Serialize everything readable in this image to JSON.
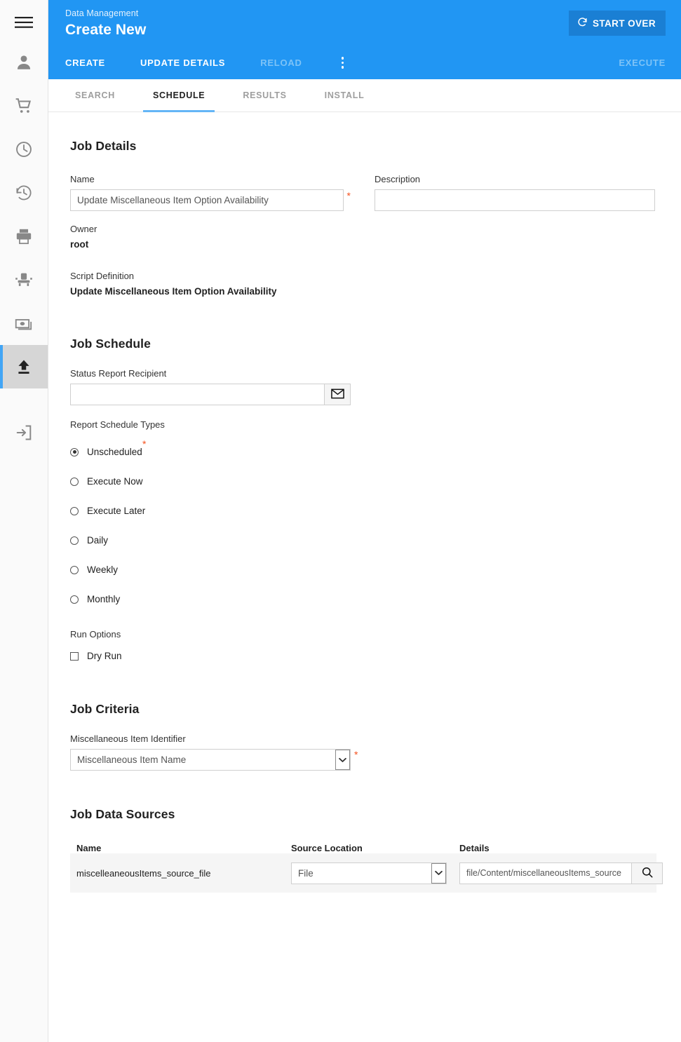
{
  "sidebar": {
    "items": [
      {
        "icon": "hamburger-menu-icon",
        "name": "menu-toggle"
      },
      {
        "icon": "person-icon",
        "name": "sidebar-item-person"
      },
      {
        "icon": "shopping-cart-icon",
        "name": "sidebar-item-cart"
      },
      {
        "icon": "clock-icon",
        "name": "sidebar-item-clock"
      },
      {
        "icon": "history-icon",
        "name": "sidebar-item-history"
      },
      {
        "icon": "printer-icon",
        "name": "sidebar-item-printer"
      },
      {
        "icon": "seat-icon",
        "name": "sidebar-item-seat"
      },
      {
        "icon": "cash-icon",
        "name": "sidebar-item-cash"
      },
      {
        "icon": "upload-icon",
        "name": "sidebar-item-upload"
      },
      {
        "icon": "logout-icon",
        "name": "sidebar-item-logout"
      }
    ]
  },
  "header": {
    "breadcrumb": "Data Management",
    "title": "Create New",
    "start_over_label": "START OVER",
    "accent_color": "#2196f3",
    "start_over_color": "#1a7fd4"
  },
  "toolbar": {
    "create_label": "CREATE",
    "update_details_label": "UPDATE DETAILS",
    "reload_label": "RELOAD",
    "execute_label": "EXECUTE"
  },
  "tabs": [
    {
      "label": "SEARCH",
      "active": false
    },
    {
      "label": "SCHEDULE",
      "active": true
    },
    {
      "label": "RESULTS",
      "active": false
    },
    {
      "label": "INSTALL",
      "active": false
    }
  ],
  "job_details": {
    "heading": "Job Details",
    "name_label": "Name",
    "name_value": "Update Miscellaneous Item Option Availability",
    "name_required": "*",
    "description_label": "Description",
    "description_value": "",
    "owner_label": "Owner",
    "owner_value": "root",
    "script_definition_label": "Script Definition",
    "script_definition_value": "Update Miscellaneous Item Option Availability"
  },
  "job_schedule": {
    "heading": "Job Schedule",
    "recipient_label": "Status Report Recipient",
    "recipient_value": "",
    "email_button_icon": "envelope-icon",
    "schedule_types_label": "Report Schedule Types",
    "schedule_required": "*",
    "schedule_types": [
      {
        "label": "Unscheduled",
        "checked": true
      },
      {
        "label": "Execute Now",
        "checked": false
      },
      {
        "label": "Execute Later",
        "checked": false
      },
      {
        "label": "Daily",
        "checked": false
      },
      {
        "label": "Weekly",
        "checked": false
      },
      {
        "label": "Monthly",
        "checked": false
      }
    ],
    "run_options_label": "Run Options",
    "dry_run_label": "Dry Run",
    "dry_run_checked": false
  },
  "job_criteria": {
    "heading": "Job Criteria",
    "identifier_label": "Miscellaneous Item Identifier",
    "identifier_value": "Miscellaneous Item Name",
    "identifier_required": "*"
  },
  "job_data_sources": {
    "heading": "Job Data Sources",
    "columns": [
      "Name",
      "Source Location",
      "Details"
    ],
    "rows": [
      {
        "name": "miscelleaneousItems_source_file",
        "source_location": "File",
        "details": "file/Content/miscellaneousItems_source",
        "search_icon": "search-icon"
      }
    ]
  }
}
